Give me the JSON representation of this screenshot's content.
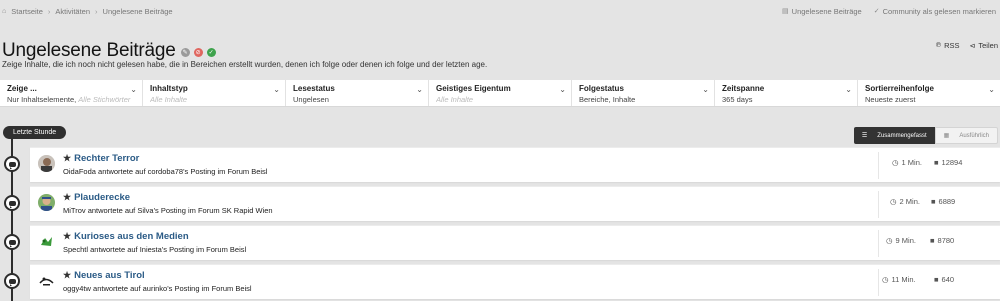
{
  "breadcrumb": {
    "home": "Startseite",
    "activities": "Aktivitäten",
    "current": "Ungelesene Beiträge"
  },
  "topbar": {
    "unread_link": "Ungelesene Beiträge",
    "mark_read": "Community als gelesen markieren"
  },
  "page": {
    "title": "Ungelesene Beiträge",
    "subtitle": "Zeige Inhalte, die ich noch nicht gelesen habe, die in Bereichen erstellt wurden, denen ich folge oder denen ich folge und der letzten age."
  },
  "actions": {
    "rss": "RSS",
    "share": "Teilen"
  },
  "filters": [
    {
      "label": "Zeige ...",
      "value": "Nur Inhaltselemente,",
      "placeholder": "Alle Stichwörter"
    },
    {
      "label": "Inhaltstyp",
      "value": "",
      "placeholder": "Alle Inhalte"
    },
    {
      "label": "Lesestatus",
      "value": "Ungelesen",
      "placeholder": ""
    },
    {
      "label": "Geistiges Eigentum",
      "value": "",
      "placeholder": "Alle Inhalte"
    },
    {
      "label": "Folgestatus",
      "value": "Bereiche, Inhalte",
      "placeholder": ""
    },
    {
      "label": "Zeitspanne",
      "value": "365 days",
      "placeholder": ""
    },
    {
      "label": "Sortierreihenfolge",
      "value": "Neueste zuerst",
      "placeholder": ""
    }
  ],
  "timeline": {
    "section_label": "Letzte Stunde"
  },
  "view_toggle": {
    "condensed": "Zusammengefasst",
    "expanded": "Ausführlich"
  },
  "items": [
    {
      "title": "Rechter Terror",
      "subtitle": "OidaFoda antwortete auf cordoba78's Posting im Forum Beisl",
      "time": "1 Min.",
      "replies": "12894"
    },
    {
      "title": "Plauderecke",
      "subtitle": "MiTrov antwortete auf Silva's Posting im Forum SK Rapid Wien",
      "time": "2 Min.",
      "replies": "6889"
    },
    {
      "title": "Kurioses aus den Medien",
      "subtitle": "Spechtl antwortete auf Iniesta's Posting im Forum Beisl",
      "time": "9 Min.",
      "replies": "8780"
    },
    {
      "title": "Neues aus Tirol",
      "subtitle": "oggy4tw antwortete auf aurinko's Posting im Forum Beisl",
      "time": "11 Min.",
      "replies": "640"
    }
  ]
}
